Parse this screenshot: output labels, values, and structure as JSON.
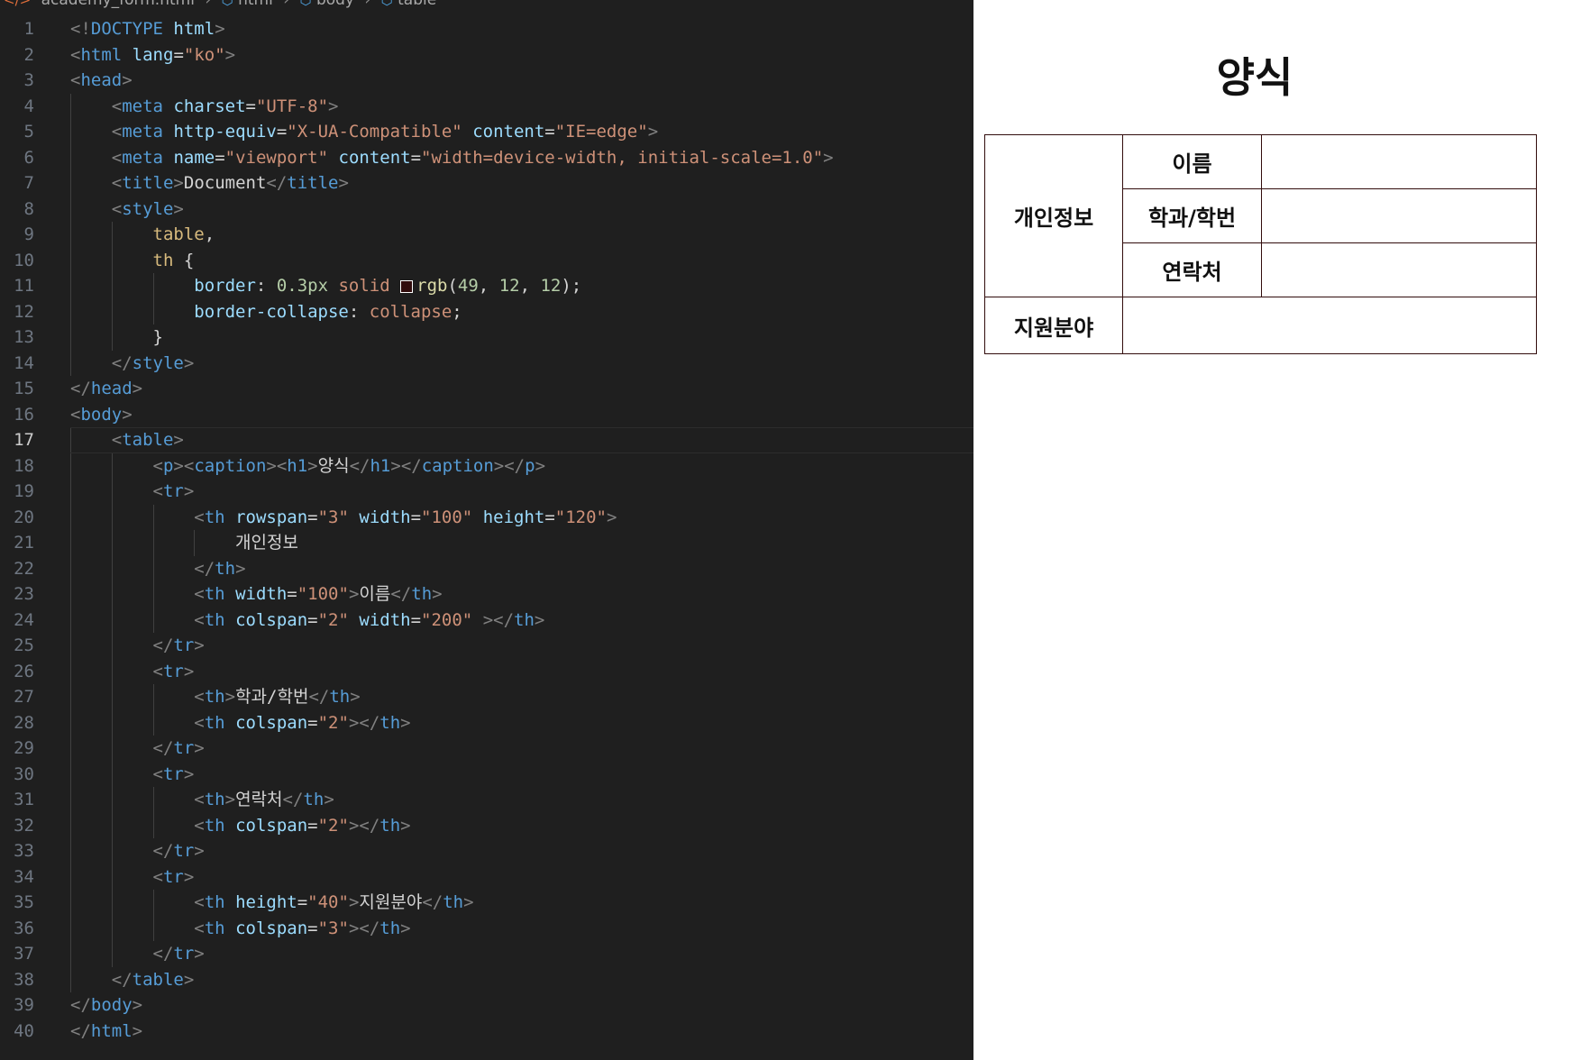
{
  "breadcrumb": [
    "academy_form.html",
    "html",
    "body",
    "table"
  ],
  "active_line": 17,
  "code_lines": [
    [
      [
        "p",
        "<!"
      ],
      [
        "t",
        "DOCTYPE"
      ],
      [
        "x",
        " "
      ],
      [
        "a",
        "html"
      ],
      [
        "p",
        ">"
      ]
    ],
    [
      [
        "p",
        "<"
      ],
      [
        "t",
        "html"
      ],
      [
        "x",
        " "
      ],
      [
        "a",
        "lang"
      ],
      [
        "x",
        "="
      ],
      [
        "s",
        "\"ko\""
      ],
      [
        "p",
        ">"
      ]
    ],
    [
      [
        "p",
        "<"
      ],
      [
        "t",
        "head"
      ],
      [
        "p",
        ">"
      ]
    ],
    [
      [
        "x",
        "    "
      ],
      [
        "p",
        "<"
      ],
      [
        "t",
        "meta"
      ],
      [
        "x",
        " "
      ],
      [
        "a",
        "charset"
      ],
      [
        "x",
        "="
      ],
      [
        "s",
        "\"UTF-8\""
      ],
      [
        "p",
        ">"
      ]
    ],
    [
      [
        "x",
        "    "
      ],
      [
        "p",
        "<"
      ],
      [
        "t",
        "meta"
      ],
      [
        "x",
        " "
      ],
      [
        "a",
        "http-equiv"
      ],
      [
        "x",
        "="
      ],
      [
        "s",
        "\"X-UA-Compatible\""
      ],
      [
        "x",
        " "
      ],
      [
        "a",
        "content"
      ],
      [
        "x",
        "="
      ],
      [
        "s",
        "\"IE=edge\""
      ],
      [
        "p",
        ">"
      ]
    ],
    [
      [
        "x",
        "    "
      ],
      [
        "p",
        "<"
      ],
      [
        "t",
        "meta"
      ],
      [
        "x",
        " "
      ],
      [
        "a",
        "name"
      ],
      [
        "x",
        "="
      ],
      [
        "s",
        "\"viewport\""
      ],
      [
        "x",
        " "
      ],
      [
        "a",
        "content"
      ],
      [
        "x",
        "="
      ],
      [
        "s",
        "\"width=device-width, initial-scale=1.0\""
      ],
      [
        "p",
        ">"
      ]
    ],
    [
      [
        "x",
        "    "
      ],
      [
        "p",
        "<"
      ],
      [
        "t",
        "title"
      ],
      [
        "p",
        ">"
      ],
      [
        "x",
        "Document"
      ],
      [
        "p",
        "</"
      ],
      [
        "t",
        "title"
      ],
      [
        "p",
        ">"
      ]
    ],
    [
      [
        "x",
        "    "
      ],
      [
        "p",
        "<"
      ],
      [
        "t",
        "style"
      ],
      [
        "p",
        ">"
      ]
    ],
    [
      [
        "x",
        "        "
      ],
      [
        "sel",
        "table"
      ],
      [
        "x",
        ","
      ]
    ],
    [
      [
        "x",
        "        "
      ],
      [
        "sel",
        "th"
      ],
      [
        "x",
        " {"
      ]
    ],
    [
      [
        "x",
        "            "
      ],
      [
        "pr",
        "border"
      ],
      [
        "x",
        ": "
      ],
      [
        "n",
        "0.3px"
      ],
      [
        "x",
        " "
      ],
      [
        "s",
        "solid"
      ],
      [
        "x",
        " "
      ],
      [
        "swatch",
        ""
      ],
      [
        "f",
        "rgb"
      ],
      [
        "x",
        "("
      ],
      [
        "n",
        "49"
      ],
      [
        "x",
        ", "
      ],
      [
        "n",
        "12"
      ],
      [
        "x",
        ", "
      ],
      [
        "n",
        "12"
      ],
      [
        "x",
        ");"
      ]
    ],
    [
      [
        "x",
        "            "
      ],
      [
        "pr",
        "border-collapse"
      ],
      [
        "x",
        ": "
      ],
      [
        "s",
        "collapse"
      ],
      [
        "x",
        ";"
      ]
    ],
    [
      [
        "x",
        "        }"
      ]
    ],
    [
      [
        "x",
        "    "
      ],
      [
        "p",
        "</"
      ],
      [
        "t",
        "style"
      ],
      [
        "p",
        ">"
      ]
    ],
    [
      [
        "p",
        "</"
      ],
      [
        "t",
        "head"
      ],
      [
        "p",
        ">"
      ]
    ],
    [
      [
        "p",
        "<"
      ],
      [
        "t",
        "body"
      ],
      [
        "p",
        ">"
      ]
    ],
    [
      [
        "x",
        "    "
      ],
      [
        "p",
        "<"
      ],
      [
        "t",
        "table"
      ],
      [
        "p",
        ">"
      ]
    ],
    [
      [
        "x",
        "        "
      ],
      [
        "p",
        "<"
      ],
      [
        "t",
        "p"
      ],
      [
        "p",
        "><"
      ],
      [
        "t",
        "caption"
      ],
      [
        "p",
        "><"
      ],
      [
        "t",
        "h1"
      ],
      [
        "p",
        ">"
      ],
      [
        "x",
        "양식"
      ],
      [
        "p",
        "</"
      ],
      [
        "t",
        "h1"
      ],
      [
        "p",
        "></"
      ],
      [
        "t",
        "caption"
      ],
      [
        "p",
        "></"
      ],
      [
        "t",
        "p"
      ],
      [
        "p",
        ">"
      ]
    ],
    [
      [
        "x",
        "        "
      ],
      [
        "p",
        "<"
      ],
      [
        "t",
        "tr"
      ],
      [
        "p",
        ">"
      ]
    ],
    [
      [
        "x",
        "            "
      ],
      [
        "p",
        "<"
      ],
      [
        "t",
        "th"
      ],
      [
        "x",
        " "
      ],
      [
        "a",
        "rowspan"
      ],
      [
        "x",
        "="
      ],
      [
        "s",
        "\"3\""
      ],
      [
        "x",
        " "
      ],
      [
        "a",
        "width"
      ],
      [
        "x",
        "="
      ],
      [
        "s",
        "\"100\""
      ],
      [
        "x",
        " "
      ],
      [
        "a",
        "height"
      ],
      [
        "x",
        "="
      ],
      [
        "s",
        "\"120\""
      ],
      [
        "p",
        ">"
      ]
    ],
    [
      [
        "x",
        "                개인정보"
      ]
    ],
    [
      [
        "x",
        "            "
      ],
      [
        "p",
        "</"
      ],
      [
        "t",
        "th"
      ],
      [
        "p",
        ">"
      ]
    ],
    [
      [
        "x",
        "            "
      ],
      [
        "p",
        "<"
      ],
      [
        "t",
        "th"
      ],
      [
        "x",
        " "
      ],
      [
        "a",
        "width"
      ],
      [
        "x",
        "="
      ],
      [
        "s",
        "\"100\""
      ],
      [
        "p",
        ">"
      ],
      [
        "x",
        "이름"
      ],
      [
        "p",
        "</"
      ],
      [
        "t",
        "th"
      ],
      [
        "p",
        ">"
      ]
    ],
    [
      [
        "x",
        "            "
      ],
      [
        "p",
        "<"
      ],
      [
        "t",
        "th"
      ],
      [
        "x",
        " "
      ],
      [
        "a",
        "colspan"
      ],
      [
        "x",
        "="
      ],
      [
        "s",
        "\"2\""
      ],
      [
        "x",
        " "
      ],
      [
        "a",
        "width"
      ],
      [
        "x",
        "="
      ],
      [
        "s",
        "\"200\""
      ],
      [
        "x",
        " "
      ],
      [
        "p",
        "></"
      ],
      [
        "t",
        "th"
      ],
      [
        "p",
        ">"
      ]
    ],
    [
      [
        "x",
        "        "
      ],
      [
        "p",
        "</"
      ],
      [
        "t",
        "tr"
      ],
      [
        "p",
        ">"
      ]
    ],
    [
      [
        "x",
        "        "
      ],
      [
        "p",
        "<"
      ],
      [
        "t",
        "tr"
      ],
      [
        "p",
        ">"
      ]
    ],
    [
      [
        "x",
        "            "
      ],
      [
        "p",
        "<"
      ],
      [
        "t",
        "th"
      ],
      [
        "p",
        ">"
      ],
      [
        "x",
        "학과/학번"
      ],
      [
        "p",
        "</"
      ],
      [
        "t",
        "th"
      ],
      [
        "p",
        ">"
      ]
    ],
    [
      [
        "x",
        "            "
      ],
      [
        "p",
        "<"
      ],
      [
        "t",
        "th"
      ],
      [
        "x",
        " "
      ],
      [
        "a",
        "colspan"
      ],
      [
        "x",
        "="
      ],
      [
        "s",
        "\"2\""
      ],
      [
        "p",
        "></"
      ],
      [
        "t",
        "th"
      ],
      [
        "p",
        ">"
      ]
    ],
    [
      [
        "x",
        "        "
      ],
      [
        "p",
        "</"
      ],
      [
        "t",
        "tr"
      ],
      [
        "p",
        ">"
      ]
    ],
    [
      [
        "x",
        "        "
      ],
      [
        "p",
        "<"
      ],
      [
        "t",
        "tr"
      ],
      [
        "p",
        ">"
      ]
    ],
    [
      [
        "x",
        "            "
      ],
      [
        "p",
        "<"
      ],
      [
        "t",
        "th"
      ],
      [
        "p",
        ">"
      ],
      [
        "x",
        "연락처"
      ],
      [
        "p",
        "</"
      ],
      [
        "t",
        "th"
      ],
      [
        "p",
        ">"
      ]
    ],
    [
      [
        "x",
        "            "
      ],
      [
        "p",
        "<"
      ],
      [
        "t",
        "th"
      ],
      [
        "x",
        " "
      ],
      [
        "a",
        "colspan"
      ],
      [
        "x",
        "="
      ],
      [
        "s",
        "\"2\""
      ],
      [
        "p",
        "></"
      ],
      [
        "t",
        "th"
      ],
      [
        "p",
        ">"
      ]
    ],
    [
      [
        "x",
        "        "
      ],
      [
        "p",
        "</"
      ],
      [
        "t",
        "tr"
      ],
      [
        "p",
        ">"
      ]
    ],
    [
      [
        "x",
        "        "
      ],
      [
        "p",
        "<"
      ],
      [
        "t",
        "tr"
      ],
      [
        "p",
        ">"
      ]
    ],
    [
      [
        "x",
        "            "
      ],
      [
        "p",
        "<"
      ],
      [
        "t",
        "th"
      ],
      [
        "x",
        " "
      ],
      [
        "a",
        "height"
      ],
      [
        "x",
        "="
      ],
      [
        "s",
        "\"40\""
      ],
      [
        "p",
        ">"
      ],
      [
        "x",
        "지원분야"
      ],
      [
        "p",
        "</"
      ],
      [
        "t",
        "th"
      ],
      [
        "p",
        ">"
      ]
    ],
    [
      [
        "x",
        "            "
      ],
      [
        "p",
        "<"
      ],
      [
        "t",
        "th"
      ],
      [
        "x",
        " "
      ],
      [
        "a",
        "colspan"
      ],
      [
        "x",
        "="
      ],
      [
        "s",
        "\"3\""
      ],
      [
        "p",
        "></"
      ],
      [
        "t",
        "th"
      ],
      [
        "p",
        ">"
      ]
    ],
    [
      [
        "x",
        "        "
      ],
      [
        "p",
        "</"
      ],
      [
        "t",
        "tr"
      ],
      [
        "p",
        ">"
      ]
    ],
    [
      [
        "x",
        "    "
      ],
      [
        "p",
        "</"
      ],
      [
        "t",
        "table"
      ],
      [
        "p",
        ">"
      ]
    ],
    [
      [
        "p",
        "</"
      ],
      [
        "t",
        "body"
      ],
      [
        "p",
        ">"
      ]
    ],
    [
      [
        "p",
        "</"
      ],
      [
        "t",
        "html"
      ],
      [
        "p",
        ">"
      ]
    ]
  ],
  "preview": {
    "caption": "양식",
    "rows": {
      "personal_info": "개인정보",
      "name": "이름",
      "department_id": "학과/학번",
      "contact": "연락처",
      "field": "지원분야"
    }
  },
  "colors": {
    "editor_bg": "#1f1f1f",
    "tag": "#569cd6",
    "attribute": "#9cdcfe",
    "string": "#ce9178",
    "table_border": "rgb(49, 12, 12)"
  }
}
